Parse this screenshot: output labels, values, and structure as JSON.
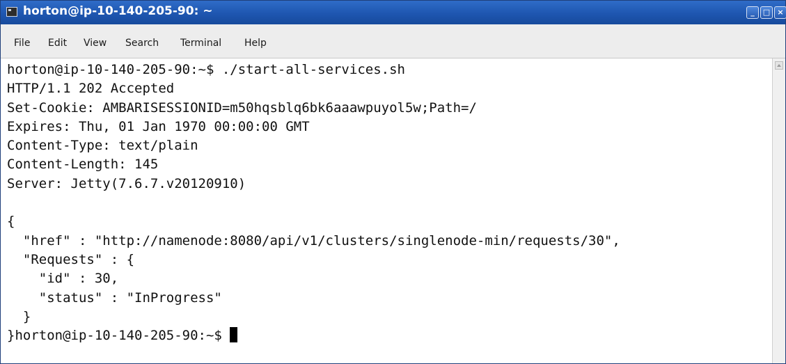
{
  "window": {
    "title": "horton@ip-10-140-205-90: ~",
    "buttons": {
      "minimize": "_",
      "maximize": "□",
      "close": "×"
    }
  },
  "menu": [
    "File",
    "Edit",
    "View",
    "Search",
    "Terminal",
    "Help"
  ],
  "terminal": {
    "lines": [
      "horton@ip-10-140-205-90:~$ ./start-all-services.sh",
      "HTTP/1.1 202 Accepted",
      "Set-Cookie: AMBARISESSIONID=m50hqsblq6bk6aaawpuyol5w;Path=/",
      "Expires: Thu, 01 Jan 1970 00:00:00 GMT",
      "Content-Type: text/plain",
      "Content-Length: 145",
      "Server: Jetty(7.6.7.v20120910)",
      "",
      "{",
      "  \"href\" : \"http://namenode:8080/api/v1/clusters/singlenode-min/requests/30\",",
      "  \"Requests\" : {",
      "    \"id\" : 30,",
      "    \"status\" : \"InProgress\"",
      "  }"
    ],
    "prompt": "}horton@ip-10-140-205-90:~$ "
  },
  "colors": {
    "titlebar": "#1e56b0",
    "menubar": "#ededed",
    "terminal_bg": "#ffffff",
    "terminal_fg": "#111111"
  },
  "icons": {
    "app": "terminal-app-icon",
    "cursor": "text-cursor-block"
  }
}
